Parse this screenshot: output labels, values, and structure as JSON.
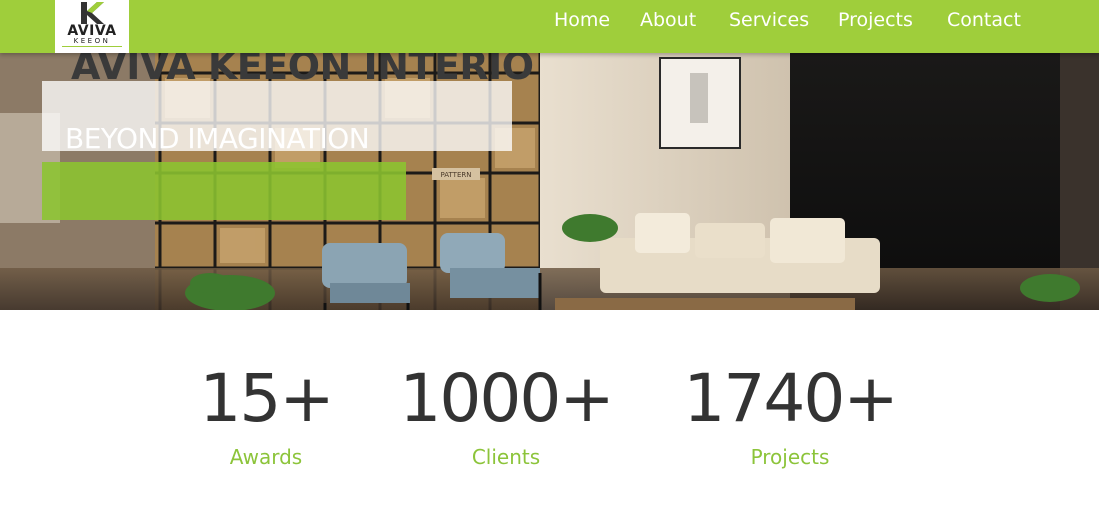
{
  "brand": {
    "logo_word": "AVIVA",
    "logo_sub": "KEEON",
    "logo_mark_letter": "K",
    "accent_color": "#9fce3b",
    "label_color": "#8cc43a"
  },
  "nav": {
    "items": [
      {
        "label": "Home"
      },
      {
        "label": "About"
      },
      {
        "label": "Services"
      },
      {
        "label": "Projects"
      },
      {
        "label": "Contact"
      }
    ]
  },
  "hero": {
    "title": "AVIVA KEEON INTERIO",
    "tagline": "BEYOND IMAGINATION",
    "image_sign": "PATTERN"
  },
  "stats": [
    {
      "value": "15+",
      "label": "Awards"
    },
    {
      "value": "1000+",
      "label": "Clients"
    },
    {
      "value": "1740+",
      "label": "Projects"
    }
  ]
}
